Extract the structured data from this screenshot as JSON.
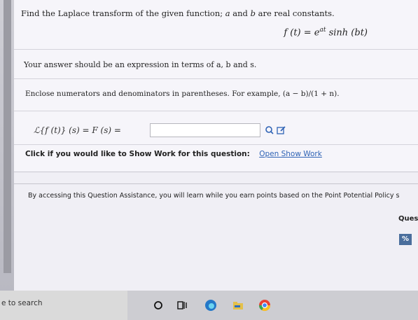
{
  "question": {
    "instruction_prefix": "Find the Laplace transform of the given function;",
    "var_a": "a",
    "and_word": "and",
    "var_b": "b",
    "instruction_suffix": "are real constants.",
    "function_expr": "f (t) = e",
    "function_exp": "at",
    "function_tail": " sinh (bt)"
  },
  "notes": {
    "answer_hint": "Your answer should be an expression in terms of a, b and s.",
    "enclose_hint": "Enclose numerators and denominators in parentheses. For example, (a − b)/(1 + n)."
  },
  "answer": {
    "label": "ℒ{f (t)} (s) = F (s) =",
    "value": ""
  },
  "show_work": {
    "label": "Click if you would like to Show Work for this question:",
    "link": "Open Show Work"
  },
  "assistance": {
    "text": "By accessing this Question Assistance, you will learn while you earn points based on the Point Potential Policy s"
  },
  "side": {
    "ques": "Ques",
    "badge": "%"
  },
  "taskbar": {
    "search_text": "e to search"
  },
  "icon_names": [
    "equation-icon",
    "edit-icon",
    "cortana-icon",
    "task-view-icon",
    "edge-icon",
    "file-explorer-icon",
    "chrome-icon"
  ]
}
